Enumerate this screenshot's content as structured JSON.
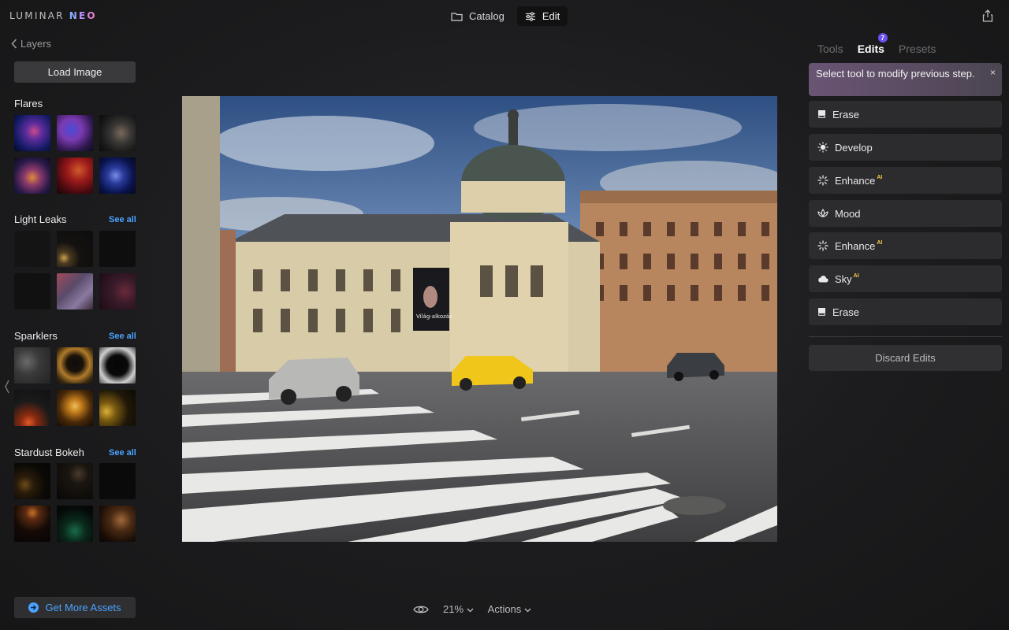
{
  "app": {
    "logo_main": "LUMINAR ",
    "logo_neo": "NEO"
  },
  "top_tabs": [
    {
      "label": "Catalog",
      "icon": "folder-icon",
      "active": false
    },
    {
      "label": "Edit",
      "icon": "sliders-icon",
      "active": true
    }
  ],
  "left_panel": {
    "back_label": "Layers",
    "load_image": "Load Image",
    "sections": [
      {
        "title": "Flares",
        "see_all": ""
      },
      {
        "title": "Light Leaks",
        "see_all": "See all"
      },
      {
        "title": "Sparklers",
        "see_all": "See all"
      },
      {
        "title": "Stardust Bokeh",
        "see_all": "See all"
      }
    ],
    "get_more_assets": "Get More Assets"
  },
  "bottom_bar": {
    "zoom": "21%",
    "actions": "Actions"
  },
  "right_panel": {
    "tabs": [
      {
        "label": "Tools",
        "active": false
      },
      {
        "label": "Edits",
        "active": true,
        "badge": "7"
      },
      {
        "label": "Presets",
        "active": false
      }
    ],
    "tooltip": "Select tool to modify previous step.",
    "tooltip_close": "×",
    "steps": [
      {
        "label": "Erase",
        "icon": "eraser-icon",
        "ai": ""
      },
      {
        "label": "Develop",
        "icon": "sun-icon",
        "ai": ""
      },
      {
        "label": "Enhance",
        "icon": "sparkle-icon",
        "ai": "AI"
      },
      {
        "label": "Mood",
        "icon": "lotus-icon",
        "ai": ""
      },
      {
        "label": "Enhance",
        "icon": "sparkle-icon",
        "ai": "AI"
      },
      {
        "label": "Sky",
        "icon": "cloud-icon",
        "ai": "AI"
      },
      {
        "label": "Erase",
        "icon": "eraser-icon",
        "ai": ""
      }
    ],
    "discard": "Discard Edits"
  },
  "photo": {
    "billboard_text": "Világ-alkozás"
  }
}
